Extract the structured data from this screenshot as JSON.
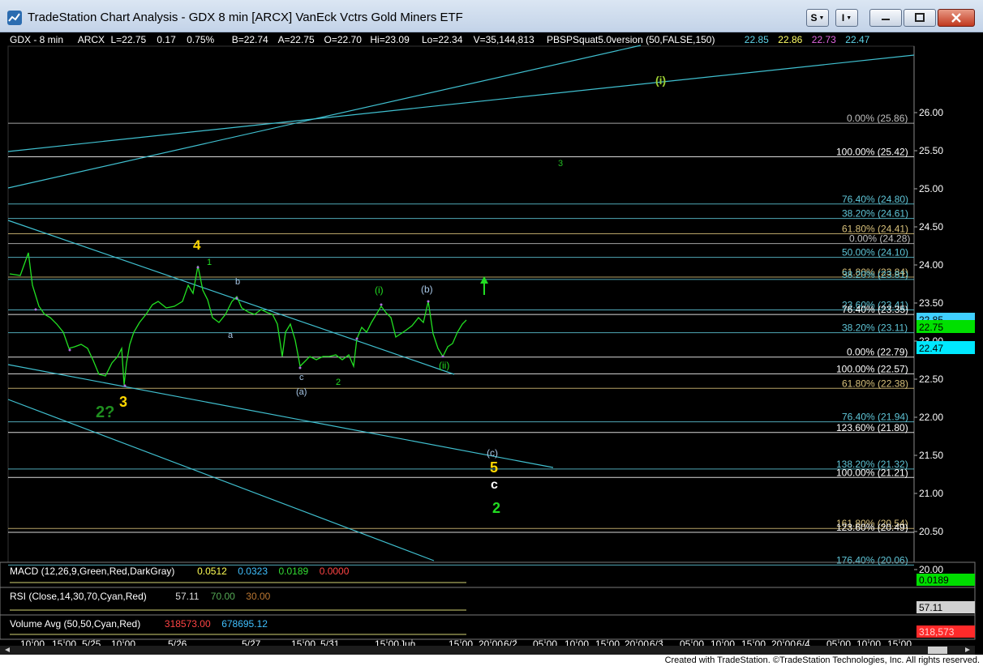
{
  "window": {
    "title": "TradeStation Chart Analysis - GDX 8 min [ARCX] VanEck Vctrs Gold Miners ETF",
    "btn_s": "S",
    "btn_i": "I",
    "minimize_icon": "minimize-icon",
    "maximize_icon": "maximize-icon",
    "close_icon": "close-icon",
    "app_icon": "tradestation-icon"
  },
  "header_line": [
    {
      "text": "GDX - 8 min",
      "color": "#ffffff"
    },
    {
      "text": "ARCX",
      "color": "#ffffff"
    },
    {
      "text": "L=22.75",
      "color": "#ffffff"
    },
    {
      "text": "0.17",
      "color": "#ffffff"
    },
    {
      "text": "0.75%",
      "color": "#ffffff"
    },
    {
      "text": "B=22.74",
      "color": "#ffffff"
    },
    {
      "text": "A=22.75",
      "color": "#ffffff"
    },
    {
      "text": "O=22.70",
      "color": "#ffffff"
    },
    {
      "text": "Hi=23.09",
      "color": "#ffffff"
    },
    {
      "text": "Lo=22.34",
      "color": "#ffffff"
    },
    {
      "text": "V=35,144,813",
      "color": "#ffffff"
    },
    {
      "text": "PBSPSquat5.0version (50,FALSE,150)",
      "color": "#ffffff"
    },
    {
      "text": "22.85",
      "color": "#5fd3e8"
    },
    {
      "text": "22.86",
      "color": "#ffff66"
    },
    {
      "text": "22.73",
      "color": "#e066e0"
    },
    {
      "text": "22.47",
      "color": "#5fd3e8"
    }
  ],
  "price_axis": [
    "26.00",
    "25.50",
    "25.00",
    "24.50",
    "24.00",
    "23.50",
    "23.00",
    "22.50",
    "22.00",
    "21.50",
    "21.00",
    "20.50",
    "20.00"
  ],
  "price_badges": [
    {
      "text": "22.85",
      "bg": "#40d0ff",
      "fg": "#000000"
    },
    {
      "text": "22.75",
      "bg": "#00e000",
      "fg": "#000000"
    },
    {
      "text": "22.47",
      "bg": "#00e8ff",
      "fg": "#000000"
    }
  ],
  "fib_levels": [
    {
      "label": "0.00% (25.86)",
      "price": 25.86,
      "color": "#c0c0c0"
    },
    {
      "label": "100.00% (25.42)",
      "price": 25.42,
      "color": "#ffffff"
    },
    {
      "label": "76.40% (24.80)",
      "price": 24.8,
      "color": "#5fc6d8"
    },
    {
      "label": "38.20% (24.61)",
      "price": 24.61,
      "color": "#5fc6d8"
    },
    {
      "label": "61.80% (24.41)",
      "price": 24.41,
      "color": "#d7c07a"
    },
    {
      "label": "0.00% (24.28)",
      "price": 24.28,
      "color": "#c0c0c0"
    },
    {
      "label": "50.00% (24.10)",
      "price": 24.1,
      "color": "#5fc6d8"
    },
    {
      "label": "61.80% (23.84)",
      "price": 23.84,
      "color": "#d7c07a"
    },
    {
      "label": "38.20% (23.81)",
      "price": 23.81,
      "color": "#5fc6d8"
    },
    {
      "label": "23.60% (23.41)",
      "price": 23.41,
      "color": "#5fc6d8"
    },
    {
      "label": "76.40% (23.35)",
      "price": 23.35,
      "color": "#ffffff"
    },
    {
      "label": "38.20% (23.11)",
      "price": 23.11,
      "color": "#5fc6d8"
    },
    {
      "label": "0.00% (22.79)",
      "price": 22.79,
      "color": "#ffffff"
    },
    {
      "label": "100.00% (22.57)",
      "price": 22.57,
      "color": "#ffffff"
    },
    {
      "label": "61.80% (22.38)",
      "price": 22.38,
      "color": "#d7c07a"
    },
    {
      "label": "76.40% (21.94)",
      "price": 21.94,
      "color": "#5fc6d8"
    },
    {
      "label": "123.60% (21.80)",
      "price": 21.8,
      "color": "#ffffff"
    },
    {
      "label": "138.20% (21.32)",
      "price": 21.32,
      "color": "#5fc6d8"
    },
    {
      "label": "100.00% (21.21)",
      "price": 21.21,
      "color": "#ffffff"
    },
    {
      "label": "161.80% (20.54)",
      "price": 20.54,
      "color": "#d7c07a"
    },
    {
      "label": "123.60% (20.49)",
      "price": 20.49,
      "color": "#ffffff"
    },
    {
      "label": "176.40% (20.06)",
      "price": 20.06,
      "color": "#5fc6d8"
    }
  ],
  "wave_labels": [
    {
      "text": "(i)",
      "color": "#9acd32",
      "bold": true,
      "size": 14
    },
    {
      "text": "3",
      "color": "#22bb22",
      "bold": false,
      "size": 11
    },
    {
      "text": "4",
      "color": "#ffd700",
      "bold": true,
      "size": 17
    },
    {
      "text": "1",
      "color": "#22dd22",
      "bold": false,
      "size": 11
    },
    {
      "text": "b",
      "color": "#a8c8e8",
      "bold": false,
      "size": 11
    },
    {
      "text": "a",
      "color": "#a8c8e8",
      "bold": false,
      "size": 11
    },
    {
      "text": "c",
      "color": "#a8c8e8",
      "bold": false,
      "size": 11
    },
    {
      "text": "(a)",
      "color": "#a8c8e8",
      "bold": false,
      "size": 11
    },
    {
      "text": "2",
      "color": "#22dd22",
      "bold": false,
      "size": 11
    },
    {
      "text": "(i)",
      "color": "#22dd22",
      "bold": false,
      "size": 12
    },
    {
      "text": "(b)",
      "color": "#a8c8e8",
      "bold": false,
      "size": 12
    },
    {
      "text": "(ii)",
      "color": "#22dd22",
      "bold": false,
      "size": 12
    },
    {
      "text": "2?",
      "color": "#1f8f1f",
      "bold": true,
      "size": 20
    },
    {
      "text": "3",
      "color": "#ffd700",
      "bold": true,
      "size": 18
    },
    {
      "text": "(c)",
      "color": "#a8c8e8",
      "bold": false,
      "size": 12
    },
    {
      "text": "5",
      "color": "#ffd700",
      "bold": true,
      "size": 18
    },
    {
      "text": "c",
      "color": "#ffffff",
      "bold": true,
      "size": 16
    },
    {
      "text": "2",
      "color": "#22dd22",
      "bold": true,
      "size": 18
    }
  ],
  "indicators": {
    "macd": {
      "name": "MACD (12,26,9,Green,Red,DarkGray)",
      "v1": "0.0512",
      "v2": "0.0323",
      "v3": "0.0189",
      "v4": "0.0000",
      "badge": "0.0189"
    },
    "rsi": {
      "name": "RSI (Close,14,30,70,Cyan,Red)",
      "v1": "57.11",
      "v2": "70.00",
      "v3": "30.00",
      "badge": "57.11"
    },
    "volume": {
      "name": "Volume Avg (50,50,Cyan,Red)",
      "v1": "318573.00",
      "v2": "678695.12",
      "badge": "318,573"
    }
  },
  "time_axis": [
    "10:00",
    "15:00",
    "5/25",
    "10:00",
    "5/26",
    "5/27",
    "15:00",
    "5/31",
    "15:00",
    "Jun",
    "15:00",
    "20:00",
    "6/2",
    "05:00",
    "10:00",
    "15:00",
    "20:00",
    "6/3",
    "05:00",
    "10:00",
    "15:00",
    "20:00",
    "6/4",
    "05:00",
    "10:00",
    "15:00"
  ],
  "status": {
    "credit": "Created with TradeStation. ©TradeStation Technologies, Inc. All rights reserved."
  },
  "colors": {
    "background": "#000000",
    "price": "#22e022",
    "trendline": "#40c0d0",
    "up_arrow": "#22dd22"
  }
}
